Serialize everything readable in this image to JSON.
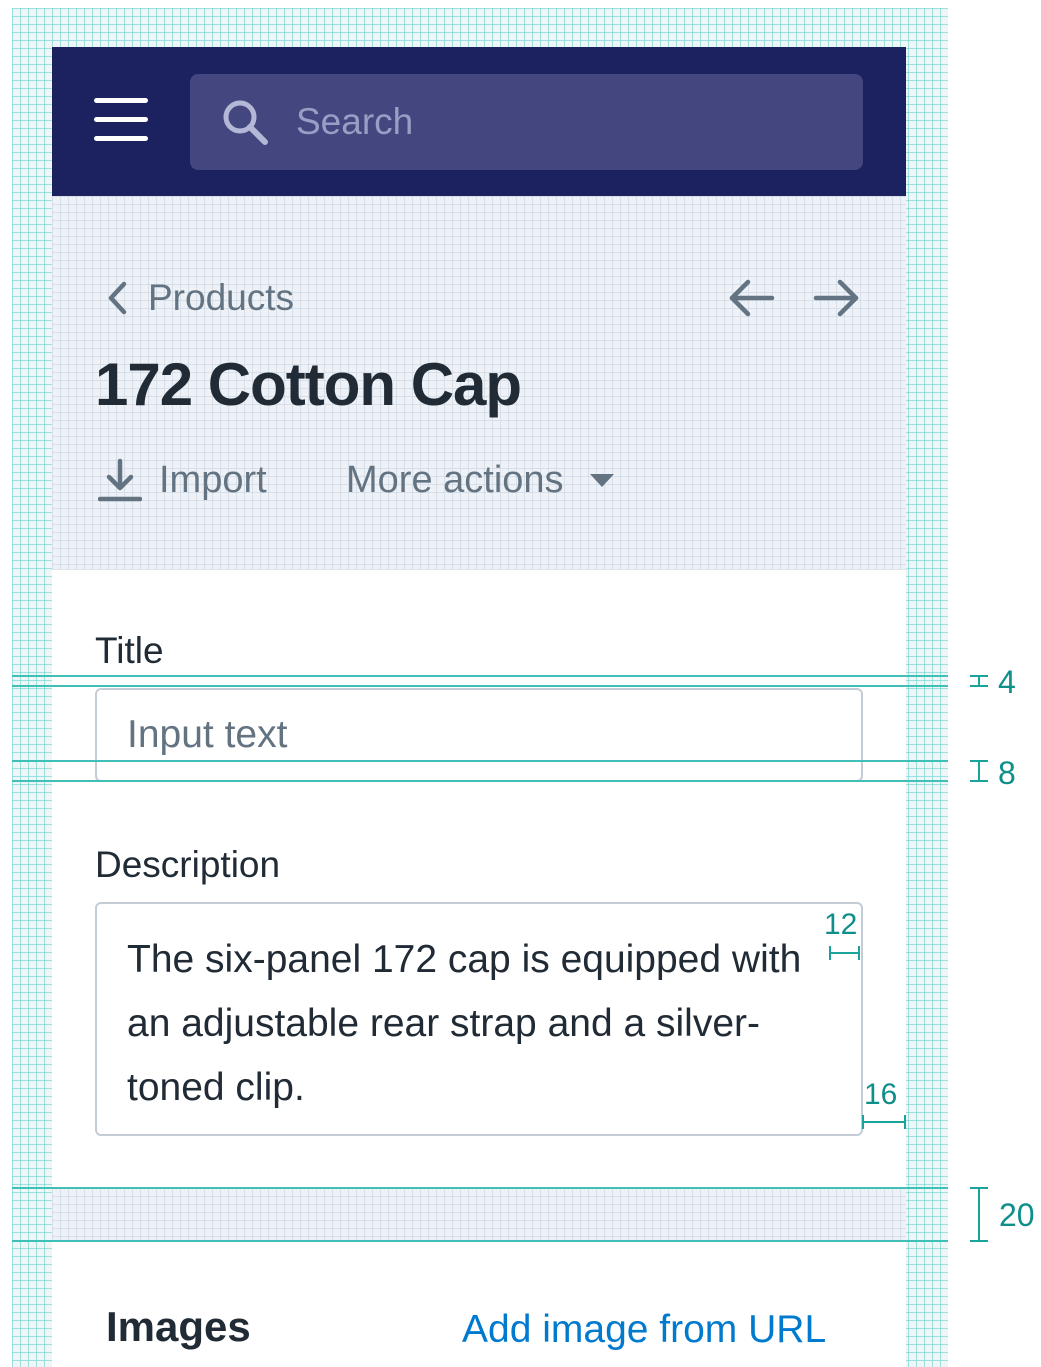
{
  "colors": {
    "topbar": "#1c2260",
    "search_bg": "#43467f",
    "text_primary": "#212b36",
    "text_subdued": "#637381",
    "link": "#007ace",
    "spec_line": "#3fbfb6"
  },
  "topbar": {
    "menu_icon": "hamburger-menu-icon",
    "search": {
      "icon": "search-icon",
      "placeholder": "Search"
    }
  },
  "header": {
    "breadcrumb": {
      "icon": "chevron-left-icon",
      "label": "Products"
    },
    "pagination": {
      "prev_icon": "arrow-left-icon",
      "next_icon": "arrow-right-icon"
    },
    "title": "172 Cotton Cap",
    "actions": [
      {
        "label": "Import",
        "icon": "import-icon"
      },
      {
        "label": "More actions",
        "icon": "caret-down-icon"
      }
    ]
  },
  "form": {
    "title_field": {
      "label": "Title",
      "placeholder": "Input text",
      "value": ""
    },
    "description_field": {
      "label": "Description",
      "value": "The six-panel 172 cap is equipped with an adjustable rear strap and a silver-toned clip."
    }
  },
  "images_card": {
    "heading": "Images",
    "action_label": "Add image from URL"
  },
  "spec_annotations": {
    "label_to_input_gap": "4",
    "input_gap": "8",
    "textarea_right_padding": "12",
    "card_padding": "16",
    "card_gap": "20"
  }
}
